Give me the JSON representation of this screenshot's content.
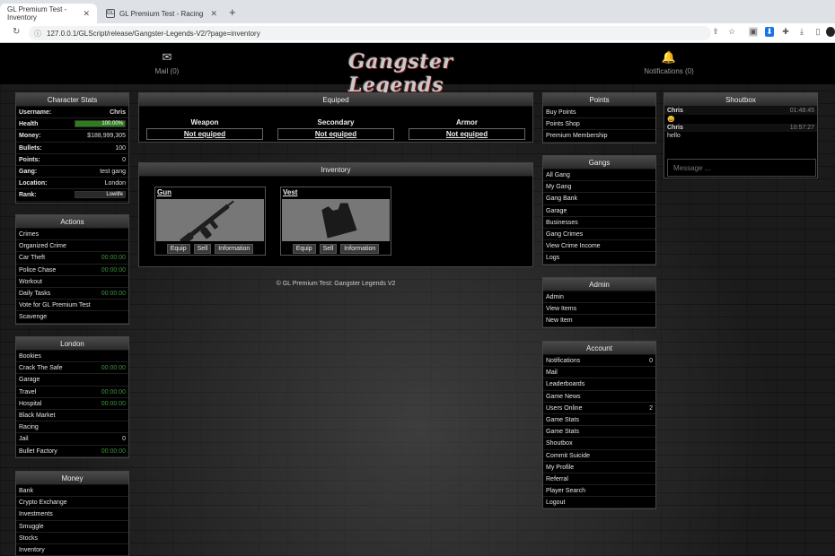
{
  "browser": {
    "tabs": [
      {
        "title": "GL Premium Test - Inventory",
        "favicon": "GL",
        "active": true
      },
      {
        "title": "GL Premium Test - Racing",
        "favicon": "GL",
        "active": false
      }
    ],
    "url": "127.0.0.1/GLScript/release/Gangster-Legends-V2/?page=inventory"
  },
  "header": {
    "mail_label": "Mail (0)",
    "notifications_label": "Notifications (0)",
    "logo_text": "Gangster Legends"
  },
  "character_stats": {
    "title": "Character Stats",
    "username_label": "Username:",
    "username": "Chris",
    "health_label": "Health",
    "health_value": "100.00%",
    "health_fraction": 1.0,
    "money_label": "Money:",
    "money": "$188,999,305",
    "bullets_label": "Bullets:",
    "bullets": "100",
    "points_label": "Points:",
    "points": "0",
    "gang_label": "Gang:",
    "gang": "test gang",
    "location_label": "Location:",
    "location": "London",
    "rank_label": "Rank:",
    "rank": "Lowlife"
  },
  "actions": {
    "title": "Actions",
    "items": [
      {
        "label": "Crimes",
        "timer": ""
      },
      {
        "label": "Organized Crime",
        "timer": ""
      },
      {
        "label": "Car Theft",
        "timer": "00:00:00"
      },
      {
        "label": "Police Chase",
        "timer": "00:00:00"
      },
      {
        "label": "Workout",
        "timer": ""
      },
      {
        "label": "Daily Tasks",
        "timer": "00:00:00"
      },
      {
        "label": "Vote for GL Premium Test",
        "timer": ""
      },
      {
        "label": "Scavenge",
        "timer": ""
      }
    ]
  },
  "london": {
    "title": "London",
    "items": [
      {
        "label": "Bookies",
        "timer": ""
      },
      {
        "label": "Crack The Safe",
        "timer": "00:00:00"
      },
      {
        "label": "Garage",
        "timer": ""
      },
      {
        "label": "Travel",
        "timer": "00:00:00"
      },
      {
        "label": "Hospital",
        "timer": "00:00:00"
      },
      {
        "label": "Black Market",
        "timer": ""
      },
      {
        "label": "Racing",
        "timer": ""
      },
      {
        "label": "Jail",
        "timer": "0"
      },
      {
        "label": "Bullet Factory",
        "timer": "00:00:00"
      }
    ]
  },
  "money": {
    "title": "Money",
    "items": [
      {
        "label": "Bank"
      },
      {
        "label": "Crypto Exchange"
      },
      {
        "label": "Investments"
      },
      {
        "label": "Smuggle"
      },
      {
        "label": "Stocks"
      },
      {
        "label": "Inventory"
      }
    ]
  },
  "equiped": {
    "title": "Equiped",
    "slots": [
      {
        "label": "Weapon",
        "value": "Not equiped"
      },
      {
        "label": "Secondary",
        "value": "Not equiped"
      },
      {
        "label": "Armor",
        "value": "Not equiped"
      }
    ]
  },
  "inventory": {
    "title": "Inventory",
    "items": [
      {
        "name": "Gun",
        "icon": "tommy-gun-icon"
      },
      {
        "name": "Vest",
        "icon": "vest-icon"
      }
    ],
    "equip_label": "Equip",
    "sell_label": "Sell",
    "info_label": "Information"
  },
  "footer": "© GL Premium Test: Gangster Legends V2",
  "points": {
    "title": "Points",
    "items": [
      {
        "label": "Buy Points"
      },
      {
        "label": "Points Shop"
      },
      {
        "label": "Premium Membership"
      }
    ]
  },
  "gangs": {
    "title": "Gangs",
    "items": [
      {
        "label": "All Gang"
      },
      {
        "label": "My Gang"
      },
      {
        "label": "Gang Bank"
      },
      {
        "label": "Garage"
      },
      {
        "label": "Businesses"
      },
      {
        "label": "Gang Crimes"
      },
      {
        "label": "View Crime Income"
      },
      {
        "label": "Logs"
      }
    ]
  },
  "admin": {
    "title": "Admin",
    "items": [
      {
        "label": "Admin"
      },
      {
        "label": "View Items"
      },
      {
        "label": "New Item"
      }
    ]
  },
  "account": {
    "title": "Account",
    "items": [
      {
        "label": "Notifications",
        "count": "0"
      },
      {
        "label": "Mail",
        "count": ""
      },
      {
        "label": "Leaderboards",
        "count": ""
      },
      {
        "label": "Game News",
        "count": ""
      },
      {
        "label": "Users Online",
        "count": "2"
      },
      {
        "label": "Game Stats",
        "count": ""
      },
      {
        "label": "Game Stats",
        "count": ""
      },
      {
        "label": "Shoutbox",
        "count": ""
      },
      {
        "label": "Commit Suicide",
        "count": ""
      },
      {
        "label": "My Profile",
        "count": ""
      },
      {
        "label": "Referral",
        "count": ""
      },
      {
        "label": "Player Search",
        "count": ""
      },
      {
        "label": "Logout",
        "count": ""
      }
    ]
  },
  "shoutbox": {
    "title": "Shoutbox",
    "messages": [
      {
        "user": "Chris",
        "time": "01:48:45",
        "text": "😀"
      },
      {
        "user": "Chris",
        "time": "10:57:27",
        "text": "hello"
      }
    ],
    "placeholder": "Message ..."
  }
}
